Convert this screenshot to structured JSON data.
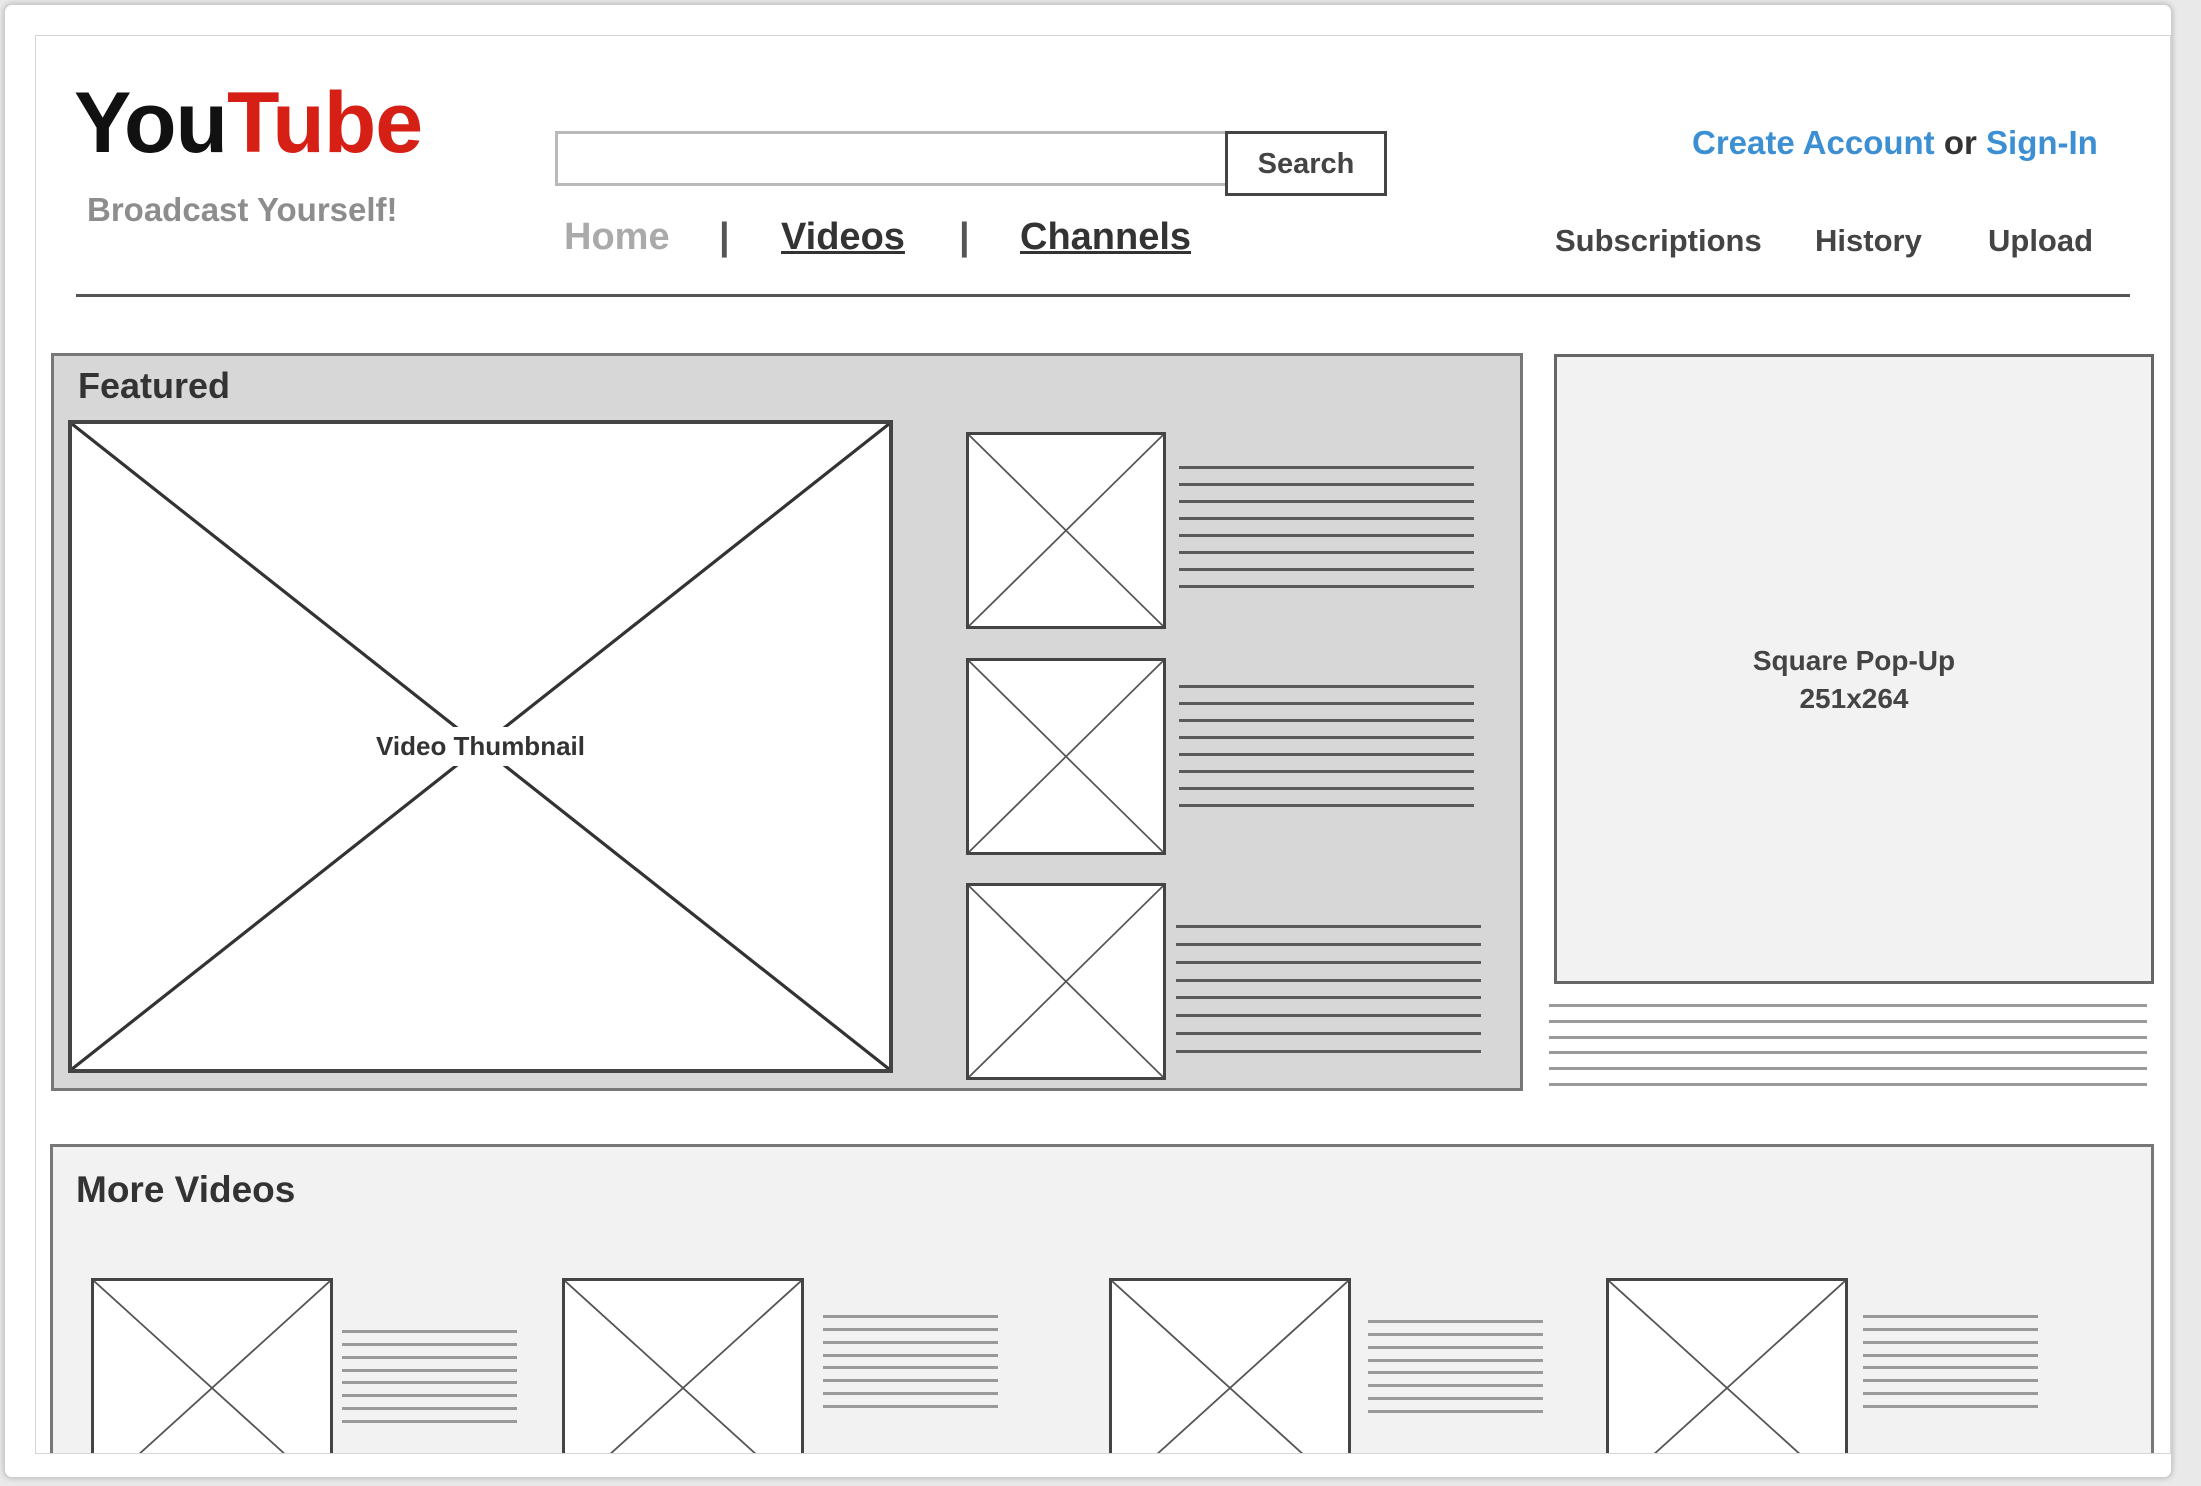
{
  "header": {
    "logo": {
      "part1": "You",
      "part2": "Tube",
      "tagline": "Broadcast Yourself!"
    },
    "search": {
      "value": "",
      "placeholder": "",
      "button_label": "Search"
    },
    "nav": {
      "home": "Home",
      "separator": "|",
      "videos": "Videos",
      "channels": "Channels"
    },
    "account": {
      "create_account": "Create Account",
      "or": "or",
      "sign_in": "Sign-In"
    },
    "links": {
      "subscriptions": "Subscriptions",
      "history": "History",
      "upload": "Upload"
    }
  },
  "featured": {
    "title": "Featured",
    "main_thumbnail_label": "Video Thumbnail"
  },
  "ad": {
    "label_line1": "Square Pop-Up",
    "label_line2": "251x264"
  },
  "more_videos": {
    "title": "More Videos"
  },
  "colors": {
    "logo_tube": "#d61f15",
    "link": "#3d8fd3",
    "featured_bg": "#d7d7d7",
    "panel_bg": "#f2f2f2"
  },
  "icons": {
    "placeholder": "crossed-box-image-placeholder"
  }
}
